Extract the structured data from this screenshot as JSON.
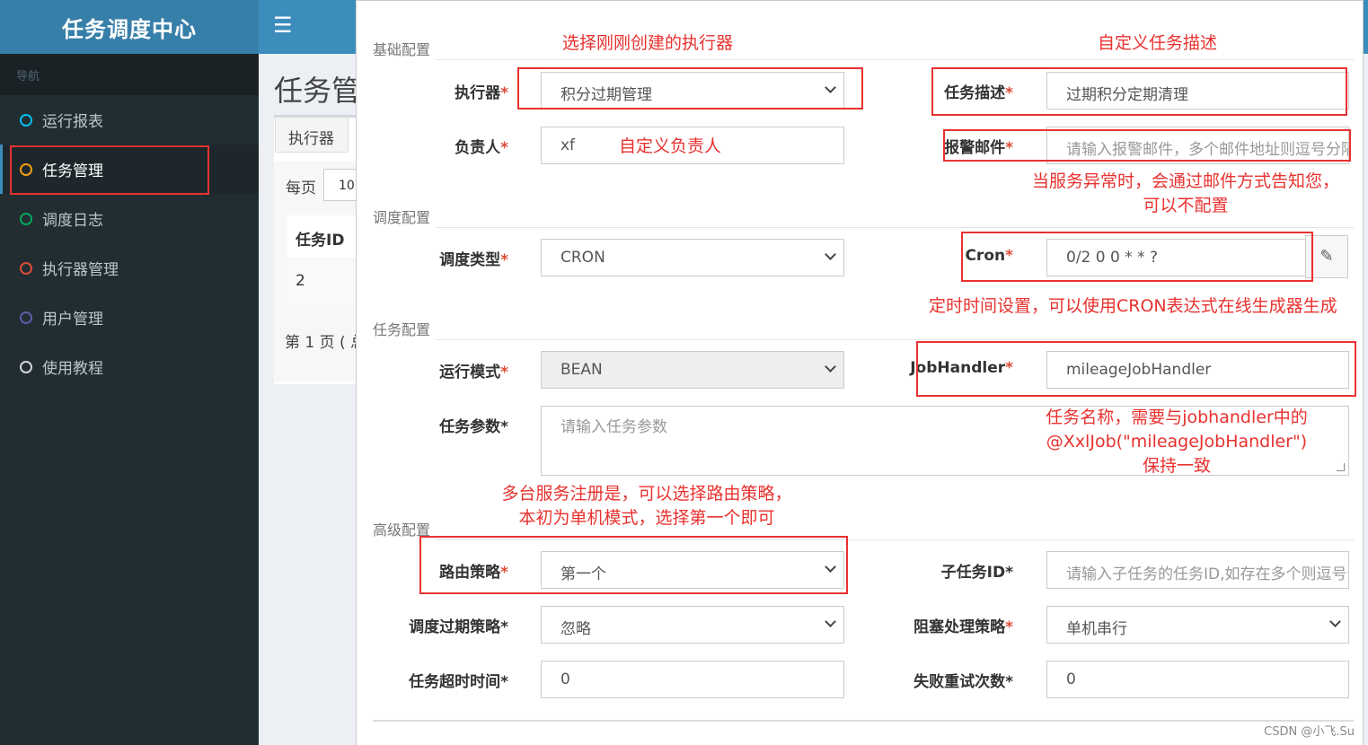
{
  "brand": {
    "title": "任务调度中心"
  },
  "topbar": {
    "menu_icon": "☰"
  },
  "sidebar": {
    "header": "导航",
    "items": [
      {
        "label": "运行报表",
        "color": "#00c0ef",
        "active": false
      },
      {
        "label": "任务管理",
        "color": "#f39c12",
        "active": true
      },
      {
        "label": "调度日志",
        "color": "#00a65a",
        "active": false
      },
      {
        "label": "执行器管理",
        "color": "#dd4b39",
        "active": false
      },
      {
        "label": "用户管理",
        "color": "#605ca8",
        "active": false
      },
      {
        "label": "使用教程",
        "color": "#d2d6de",
        "active": false
      }
    ]
  },
  "background": {
    "page_title": "任务管",
    "executor_btn": "执行器",
    "per_page": "每页",
    "per_page_value": "10",
    "col_task_id": "任务ID",
    "row_task_id": "2",
    "pager": "第 1 页 ( 总"
  },
  "form": {
    "sections": {
      "basic": "基础配置",
      "schedule": "调度配置",
      "task": "任务配置",
      "advanced": "高级配置"
    },
    "executor": {
      "label": "执行器",
      "value": "积分过期管理"
    },
    "job_desc": {
      "label": "任务描述",
      "value": "过期积分定期清理"
    },
    "author": {
      "label": "负责人",
      "value": "xf"
    },
    "alarm_email": {
      "label": "报警邮件",
      "placeholder": "请输入报警邮件，多个邮件地址则逗号分隔"
    },
    "schedule_type": {
      "label": "调度类型",
      "value": "CRON"
    },
    "cron": {
      "label": "Cron",
      "value": "0/2 0 0 * * ?",
      "icon": "✎"
    },
    "glue_type": {
      "label": "运行模式",
      "value": "BEAN"
    },
    "job_handler": {
      "label": "JobHandler",
      "value": "mileageJobHandler"
    },
    "job_param": {
      "label": "任务参数*",
      "placeholder": "请输入任务参数"
    },
    "route_strategy": {
      "label": "路由策略",
      "value": "第一个"
    },
    "child_job": {
      "label": "子任务ID*",
      "placeholder": "请输入子任务的任务ID,如存在多个则逗号分隔"
    },
    "misfire": {
      "label": "调度过期策略*",
      "value": "忽略"
    },
    "block_strategy": {
      "label": "阻塞处理策略",
      "value": "单机串行"
    },
    "timeout": {
      "label": "任务超时时间*",
      "value": "0"
    },
    "fail_retry": {
      "label": "失败重试次数*",
      "value": "0"
    }
  },
  "annotations": {
    "executor": "选择刚刚创建的执行器",
    "job_desc": "自定义任务描述",
    "author": "自定义负责人",
    "email_line1": "当服务异常时，会通过邮件方式告知您，",
    "email_line2": "可以不配置",
    "cron": "定时时间设置，可以使用CRON表达式在线生成器生成",
    "handler_line1": "任务名称，需要与jobhandler中的",
    "handler_line2": "@XxlJob(\"mileageJobHandler\")",
    "handler_line3": "保持一致",
    "route_line1": "多台服务注册是，可以选择路由策略，",
    "route_line2": "本初为单机模式，选择第一个即可"
  },
  "watermark": "CSDN @小飞.Su"
}
